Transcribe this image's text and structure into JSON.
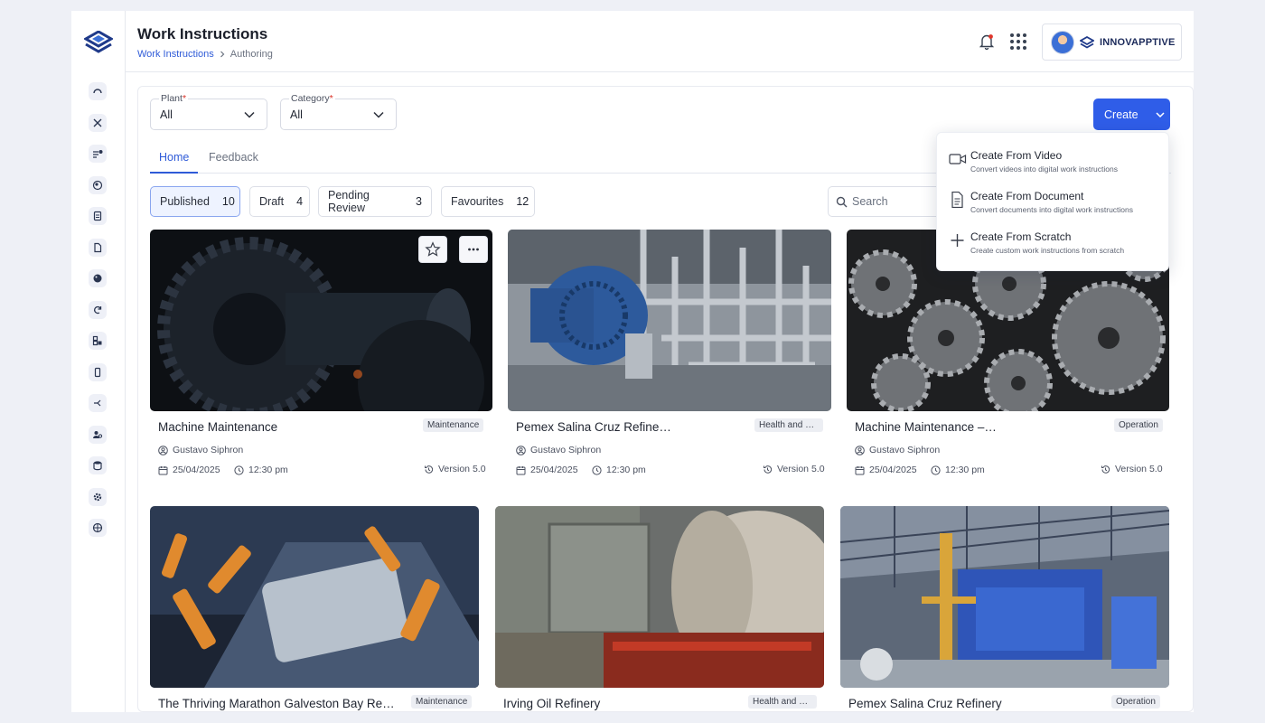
{
  "header": {
    "title": "Work Instructions",
    "breadcrumb": [
      "Work Instructions",
      "Authoring"
    ],
    "brand": "INNOVAPPTIVE"
  },
  "sidebar": {
    "icons": [
      "dashboard-icon",
      "tools-icon",
      "list-user-icon",
      "globe-icon",
      "clipboard-icon",
      "document-icon",
      "palette-icon",
      "refresh-icon",
      "modules-icon",
      "mobile-icon",
      "workflow-icon",
      "users-icon",
      "database-icon",
      "settings-icon",
      "language-icon"
    ]
  },
  "filters": {
    "plant": {
      "label": "Plant",
      "required": "*",
      "value": "All"
    },
    "category": {
      "label": "Category",
      "required": "*",
      "value": "All"
    }
  },
  "create": {
    "label": "Create",
    "menu": [
      {
        "title": "Create From Video",
        "desc": "Convert videos into digital work instructions",
        "icon": "video-icon"
      },
      {
        "title": "Create From Document",
        "desc": "Convert documents into digital work instructions",
        "icon": "document-icon"
      },
      {
        "title": "Create From Scratch",
        "desc": "Create custom work instructions from scratch",
        "icon": "plus-icon"
      }
    ]
  },
  "tabs": [
    "Home",
    "Feedback"
  ],
  "status_filters": [
    {
      "label": "Published",
      "count": "10"
    },
    {
      "label": "Draft",
      "count": "4"
    },
    {
      "label": "Pending Review",
      "count": "3"
    },
    {
      "label": "Favourites",
      "count": "12"
    }
  ],
  "search": {
    "placeholder": "Search"
  },
  "cards": [
    {
      "title": "Machine Maintenance",
      "tag": "Maintenance",
      "author": "Gustavo Siphron",
      "date": "25/04/2025",
      "time": "12:30 pm",
      "version": "Version 5.0"
    },
    {
      "title": "Pemex Salina Cruz Refine…",
      "tag": "Health and S…",
      "author": "Gustavo Siphron",
      "date": "25/04/2025",
      "time": "12:30 pm",
      "version": "Version 5.0"
    },
    {
      "title": "Machine Maintenance –…",
      "tag": "Operation",
      "author": "Gustavo Siphron",
      "date": "25/04/2025",
      "time": "12:30 pm",
      "version": "Version 5.0"
    },
    {
      "title": "The Thriving Marathon Galveston Bay Re…",
      "tag": "Maintenance"
    },
    {
      "title": "Irving Oil Refinery",
      "tag": "Health and S…"
    },
    {
      "title": "Pemex Salina Cruz Refinery",
      "tag": "Operation"
    }
  ],
  "colors": {
    "accent": "#2f5de8",
    "link": "#2f5bd8"
  }
}
